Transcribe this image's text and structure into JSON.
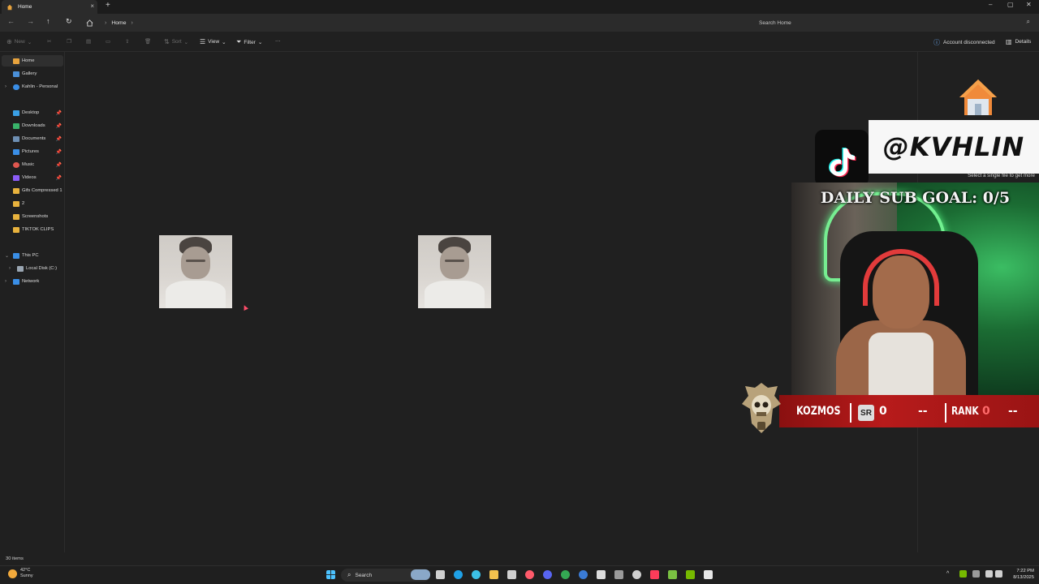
{
  "window": {
    "tab_label": "Home",
    "new_tab_symbol": "+",
    "close_tab_symbol": "×",
    "minimize_symbol": "–",
    "maximize_symbol": "▢",
    "close_symbol": "✕"
  },
  "navigation": {
    "breadcrumb": [
      "Home"
    ],
    "search_placeholder": "Search Home"
  },
  "commandbar": {
    "new_label": "New",
    "sort_label": "Sort",
    "view_label": "View",
    "filter_label": "Filter",
    "more_label": "···",
    "account_label": "Account disconnected",
    "details_label": "Details"
  },
  "sidebar": {
    "items": [
      {
        "label": "Home",
        "icon": "home-icon",
        "color": "#e8a33d",
        "selected": true
      },
      {
        "label": "Gallery",
        "icon": "gallery-icon",
        "color": "#4a90d9"
      },
      {
        "label": "Kahlin - Personal",
        "icon": "onedrive-icon",
        "color": "#3a8ee6"
      },
      {
        "label": "Desktop",
        "icon": "desktop-icon",
        "color": "#3aa0e6",
        "pinned": true
      },
      {
        "label": "Downloads",
        "icon": "download-icon",
        "color": "#39b36a",
        "pinned": true
      },
      {
        "label": "Documents",
        "icon": "document-icon",
        "color": "#6e8fb3",
        "pinned": true
      },
      {
        "label": "Pictures",
        "icon": "pictures-icon",
        "color": "#3a8ee6",
        "pinned": true
      },
      {
        "label": "Music",
        "icon": "music-icon",
        "color": "#e0574f",
        "pinned": true
      },
      {
        "label": "Videos",
        "icon": "video-icon",
        "color": "#8b5cf6",
        "pinned": true
      },
      {
        "label": "Gifs Compressed 1",
        "icon": "folder-icon",
        "color": "#e8b23d"
      },
      {
        "label": "2",
        "icon": "folder-icon",
        "color": "#e8b23d"
      },
      {
        "label": "Screenshots",
        "icon": "folder-icon",
        "color": "#e8b23d"
      },
      {
        "label": "TIKTOK CLIPS",
        "icon": "folder-icon",
        "color": "#e8b23d"
      },
      {
        "label": "This PC",
        "icon": "pc-icon",
        "color": "#3a8ee6",
        "expanded": true
      },
      {
        "label": "Local Disk (C:)",
        "icon": "drive-icon",
        "color": "#9aa6b2"
      },
      {
        "label": "Network",
        "icon": "network-icon",
        "color": "#3a8ee6"
      }
    ]
  },
  "details": {
    "hint": "Select a single file to get more"
  },
  "status": {
    "count": "30 items"
  },
  "overlay": {
    "handle": "@KVHLIN",
    "goal": "DAILY SUB GOAL: 0/5",
    "name": "KOZMOS",
    "sr_badge": "SR",
    "sr_value": "0",
    "sr_dash": "--",
    "rank_label": "RANK",
    "rank_value": "0",
    "rank_dash": "--"
  },
  "taskbar": {
    "temp": "42°C",
    "condition": "Sunny",
    "search_label": "Search",
    "time": "7:22 PM",
    "date": "8/13/2025",
    "tray_chevron": "^"
  }
}
